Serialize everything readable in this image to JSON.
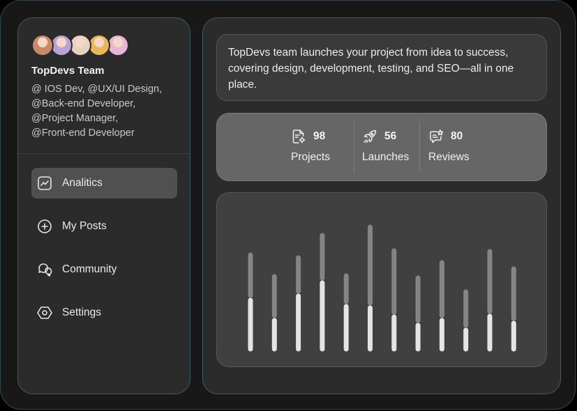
{
  "team": {
    "name": "TopDevs Team",
    "roles": [
      "@ IOS Dev, @UX/UI Design,",
      "@Back-end Developer,",
      "@Project Manager,",
      "@Front-end Developer"
    ]
  },
  "avatars": [
    {
      "name": "avatar-1",
      "color": "#c98a6a"
    },
    {
      "name": "avatar-2",
      "color": "#b7a3d6"
    },
    {
      "name": "avatar-3",
      "color": "#e7d3bd"
    },
    {
      "name": "avatar-4",
      "color": "#e8b75a"
    },
    {
      "name": "avatar-5",
      "color": "#e7b6d6"
    }
  ],
  "nav": [
    {
      "label": "Analitics",
      "icon": "chart-icon",
      "active": true
    },
    {
      "label": "My Posts",
      "icon": "plus-circle-icon",
      "active": false
    },
    {
      "label": "Community",
      "icon": "chat-bubbles-icon",
      "active": false
    },
    {
      "label": "Settings",
      "icon": "hexagon-settings-icon",
      "active": false
    }
  ],
  "description": "TopDevs team launches your project from idea to success, covering design, development, testing, and SEO—all in one place.",
  "stats": [
    {
      "value": "98",
      "label": "Projects",
      "icon": "document-gear-icon"
    },
    {
      "value": "56",
      "label": "Launches",
      "icon": "rocket-icon"
    },
    {
      "value": "80",
      "label": "Reviews",
      "icon": "message-star-icon"
    }
  ],
  "chart_data": {
    "type": "bar",
    "series": [
      {
        "values": [
          70,
          41,
          76,
          95,
          61,
          59,
          46,
          34,
          41,
          27,
          47,
          37
        ]
      },
      {
        "values": [
          58,
          56,
          48,
          61,
          37,
          109,
          88,
          61,
          76,
          48,
          86,
          71
        ]
      }
    ],
    "ylim": [
      0,
      180
    ]
  }
}
